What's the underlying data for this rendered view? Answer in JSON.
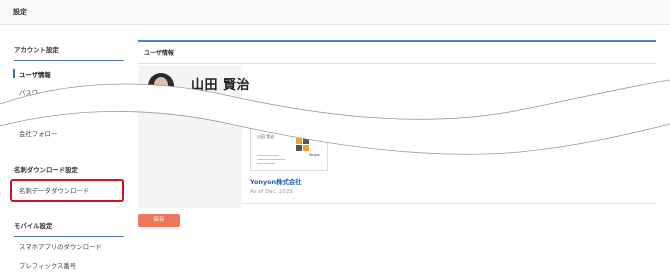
{
  "page": {
    "title": "設定"
  },
  "sidebar": {
    "sections": [
      {
        "heading": "アカウント設定",
        "items": [
          "ユーザ情報",
          "パスワード",
          "会社フォロー"
        ]
      },
      {
        "heading": "名刺ダウンロード設定",
        "items": [
          "名刺データダウンロード"
        ]
      },
      {
        "heading": "モバイル設定",
        "items": [
          "スマホアプリのダウンロード",
          "プレフィックス番号"
        ]
      }
    ],
    "active_item": "ユーザ情報",
    "highlighted_item": "名刺データダウンロード"
  },
  "panel": {
    "title": "ユーザ情報",
    "user_name": "山田 賢治",
    "card": {
      "name": "山田 賢治",
      "logo_text": "Yonyon",
      "company": "Yonyon株式会社",
      "as_of": "As of Dec, 2023"
    }
  },
  "actions": {
    "save_label": "保存"
  },
  "colors": {
    "accent": "#4f86c6",
    "save": "#ee7759",
    "highlight": "#d0121b",
    "link": "#2a5ea8"
  }
}
